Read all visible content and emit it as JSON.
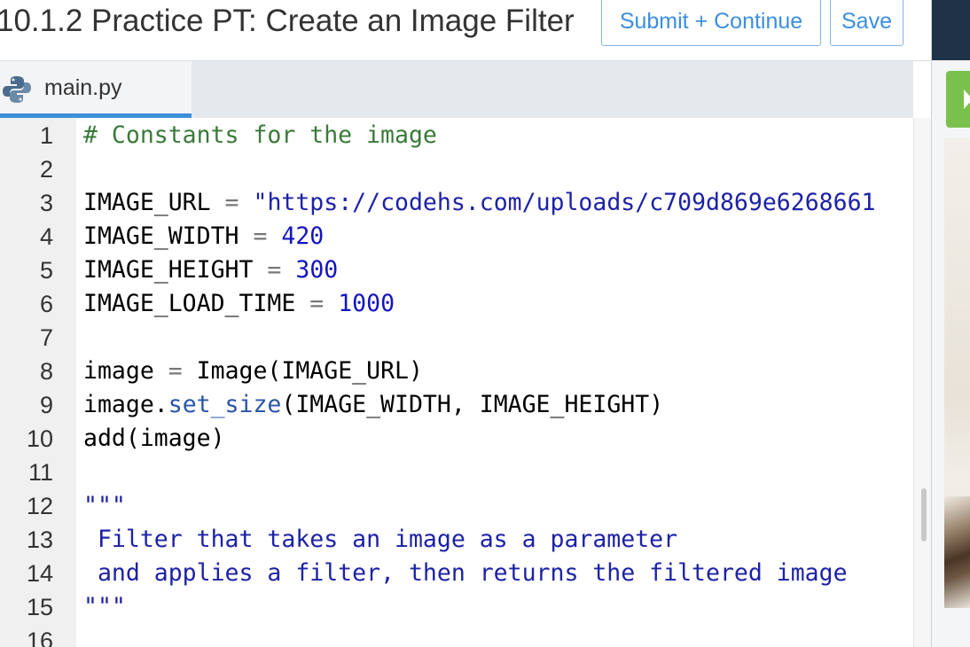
{
  "header": {
    "title": "10.1.2 Practice PT: Create an Image Filter",
    "submit_label": "Submit + Continue",
    "save_label": "Save"
  },
  "tab": {
    "icon": "python-icon",
    "label": "main.py"
  },
  "editor": {
    "lines": [
      {
        "n": "1",
        "tokens": [
          {
            "t": "# Constants for the image",
            "c": "cm"
          }
        ]
      },
      {
        "n": "2",
        "tokens": []
      },
      {
        "n": "3",
        "tokens": [
          {
            "t": "IMAGE_URL ",
            "c": ""
          },
          {
            "t": "=",
            "c": "op"
          },
          {
            "t": " ",
            "c": ""
          },
          {
            "t": "\"https://codehs.com/uploads/c709d869e6268661",
            "c": "st"
          }
        ]
      },
      {
        "n": "4",
        "tokens": [
          {
            "t": "IMAGE_WIDTH ",
            "c": ""
          },
          {
            "t": "=",
            "c": "op"
          },
          {
            "t": " ",
            "c": ""
          },
          {
            "t": "420",
            "c": "nu"
          }
        ]
      },
      {
        "n": "5",
        "tokens": [
          {
            "t": "IMAGE_HEIGHT ",
            "c": ""
          },
          {
            "t": "=",
            "c": "op"
          },
          {
            "t": " ",
            "c": ""
          },
          {
            "t": "300",
            "c": "nu"
          }
        ]
      },
      {
        "n": "6",
        "tokens": [
          {
            "t": "IMAGE_LOAD_TIME ",
            "c": ""
          },
          {
            "t": "=",
            "c": "op"
          },
          {
            "t": " ",
            "c": ""
          },
          {
            "t": "1000",
            "c": "nu"
          }
        ]
      },
      {
        "n": "7",
        "tokens": []
      },
      {
        "n": "8",
        "tokens": [
          {
            "t": "image ",
            "c": ""
          },
          {
            "t": "=",
            "c": "op"
          },
          {
            "t": " Image(IMAGE_URL)",
            "c": ""
          }
        ]
      },
      {
        "n": "9",
        "tokens": [
          {
            "t": "image.",
            "c": ""
          },
          {
            "t": "set_size",
            "c": "me"
          },
          {
            "t": "(IMAGE_WIDTH, IMAGE_HEIGHT)",
            "c": ""
          }
        ]
      },
      {
        "n": "10",
        "tokens": [
          {
            "t": "add(image)",
            "c": ""
          }
        ]
      },
      {
        "n": "11",
        "tokens": []
      },
      {
        "n": "12",
        "tokens": [
          {
            "t": "\"\"\"",
            "c": "st"
          }
        ]
      },
      {
        "n": "13",
        "tokens": [
          {
            "t": " Filter that takes an image as a parameter",
            "c": "st"
          }
        ]
      },
      {
        "n": "14",
        "tokens": [
          {
            "t": " and applies a filter, then returns the filtered image",
            "c": "st"
          }
        ]
      },
      {
        "n": "15",
        "tokens": [
          {
            "t": "\"\"\"",
            "c": "st"
          }
        ]
      },
      {
        "n": "16",
        "tokens": []
      }
    ]
  },
  "colors": {
    "accent": "#3b8fe0",
    "run_button": "#79c14c",
    "topbar_dark": "#1f3247",
    "comment": "#3a7a3a",
    "string": "#1d22a6",
    "number": "#1515c0"
  }
}
